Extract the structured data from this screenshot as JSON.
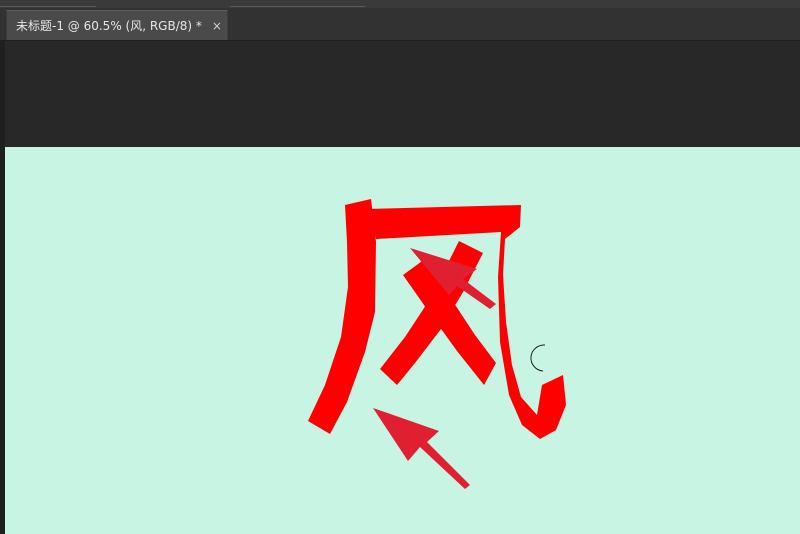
{
  "document_tab": {
    "title": "未标题-1 @ 60.5% (风, RGB/8) *",
    "close_glyph": "×"
  },
  "canvas": {
    "background": "#c8f4e4",
    "glyph": "风",
    "glyph_color": "#ff0000",
    "arrow_color": "#e02030",
    "cursor_icon": "brush-cursor-icon"
  }
}
